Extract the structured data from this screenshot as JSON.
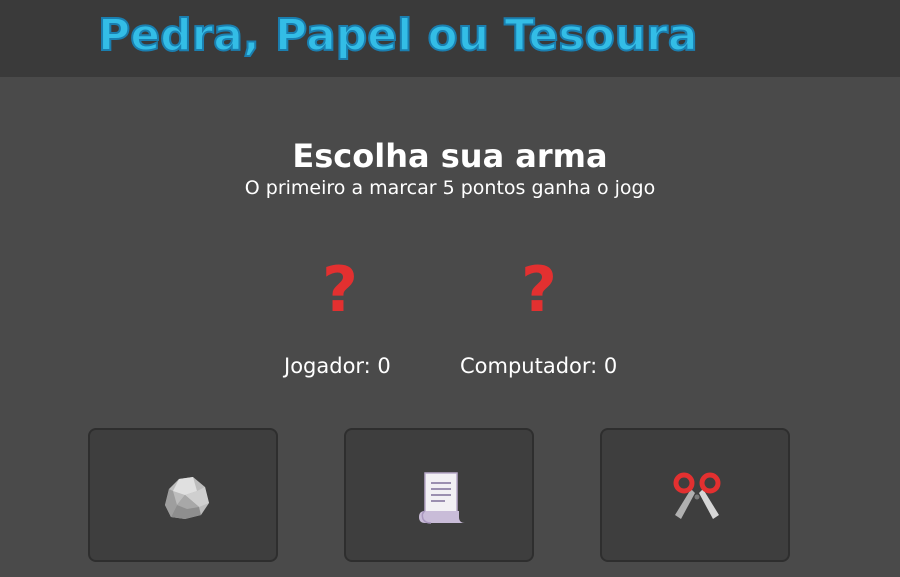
{
  "header": {
    "title": "Pedra, Papel ou Tesoura"
  },
  "main": {
    "heading": "Escolha sua arma",
    "subheading": "O primeiro a marcar 5 pontos ganha o jogo"
  },
  "choices": {
    "player_symbol": "?",
    "computer_symbol": "?"
  },
  "scores": {
    "player_label": "Jogador: 0",
    "computer_label": "Computador: 0",
    "player": 0,
    "computer": 0
  },
  "weapons": [
    {
      "name": "rock",
      "icon": "rock-icon"
    },
    {
      "name": "paper",
      "icon": "paper-scroll-icon"
    },
    {
      "name": "scissors",
      "icon": "scissors-icon"
    }
  ],
  "colors": {
    "background": "#4a4a4a",
    "header": "#3a3a3a",
    "title": "#33bde6",
    "question_mark": "#e33030"
  }
}
